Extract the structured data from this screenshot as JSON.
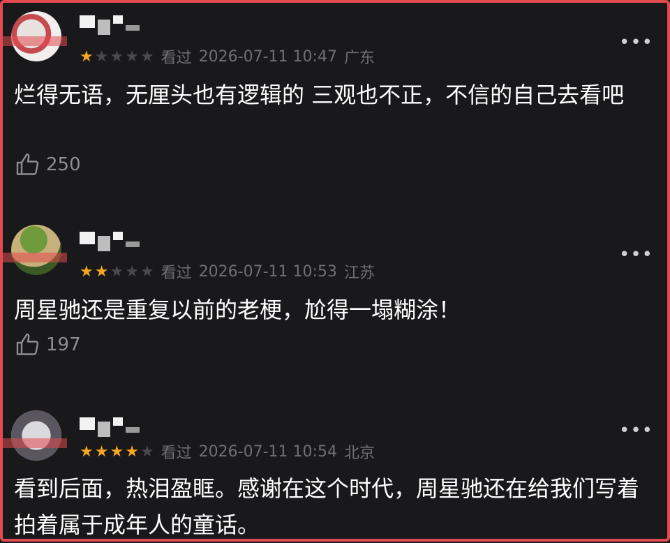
{
  "reviews": [
    {
      "rating": 1,
      "status": "看过",
      "datetime": "2026-07-11 10:47",
      "location": "广东",
      "content": "烂得无语，无厘头也有逻辑的 三观也不正，不信的自己去看吧",
      "likes": "250",
      "more": "•••"
    },
    {
      "rating": 2,
      "status": "看过",
      "datetime": "2026-07-11 10:53",
      "location": "江苏",
      "content": "周星驰还是重复以前的老梗，尬得一塌糊涂！",
      "likes": "197",
      "more": "•••"
    },
    {
      "rating": 4,
      "status": "看过",
      "datetime": "2026-07-11 10:54",
      "location": "北京",
      "content": "看到后面，热泪盈眶。感谢在这个时代，周星驰还在给我们写着拍着属于成年人的童话。",
      "more": "•••"
    }
  ],
  "colors": {
    "background": "#19191b",
    "border": "#e24a4f",
    "star_on": "#f5a623",
    "star_off": "#4a4a4e",
    "meta_text": "#6f6f74"
  },
  "icons": {
    "like": "thumb-up-icon",
    "more": "more-options-icon",
    "star": "star-icon"
  }
}
